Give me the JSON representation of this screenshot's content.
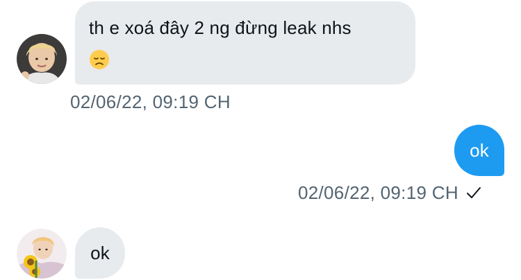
{
  "conversation": {
    "messages": [
      {
        "direction": "incoming",
        "text": "th e xoá đây 2 ng đừng leak nhs",
        "emoji": "disappointed-face-icon",
        "timestamp": "02/06/22, 09:19 CH",
        "avatar": "user-avatar-blonde"
      },
      {
        "direction": "outgoing",
        "text": "ok",
        "timestamp": "02/06/22, 09:19 CH",
        "status_icon": "checkmark-icon"
      },
      {
        "direction": "incoming",
        "text": "ok",
        "avatar": "user-avatar-sunflower"
      }
    ]
  },
  "colors": {
    "incoming_bubble": "#e7ebee",
    "outgoing_bubble": "#1d9bf0",
    "timestamp_text": "#536471"
  }
}
